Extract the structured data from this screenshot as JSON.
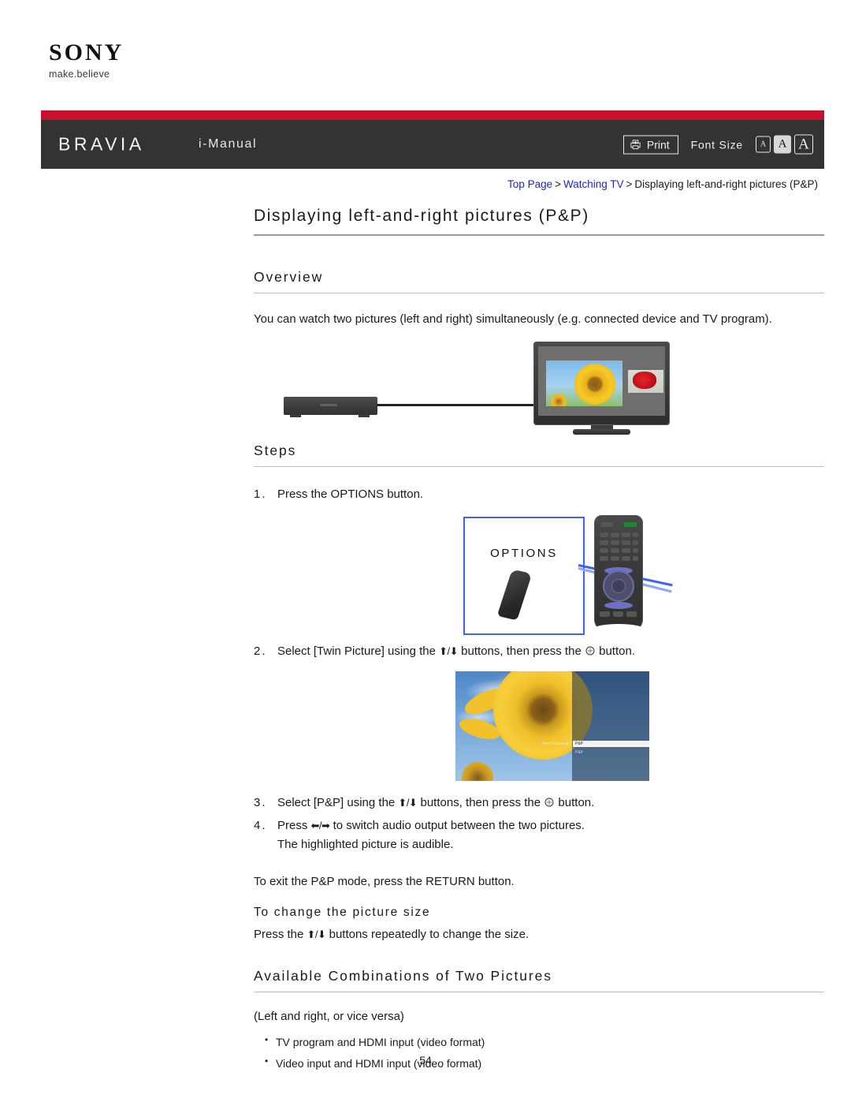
{
  "brand": {
    "logo_word": "SONY",
    "logo_tagline": "make.believe"
  },
  "header": {
    "product": "BRAVIA",
    "manual": "i-Manual",
    "print_label": "Print",
    "print_icon": "printer-icon",
    "font_size_label": "Font Size",
    "font_size_options": [
      "A",
      "A",
      "A"
    ],
    "font_size_selected_index": 1,
    "bar_red": "#c8102e",
    "bar_dark": "#333333"
  },
  "breadcrumb": {
    "items": [
      {
        "label": "Top Page",
        "link": true
      },
      {
        "label": "Watching TV",
        "link": true
      },
      {
        "label": "Displaying left-and-right pictures (P&P)",
        "link": false
      }
    ],
    "separator": ">",
    "link_color": "#2222cc"
  },
  "page": {
    "title": "Displaying left-and-right pictures (P&P)",
    "number": "54"
  },
  "overview": {
    "heading": "Overview",
    "body": "You can watch two pictures (left and right) simultaneously (e.g. connected device and TV program)."
  },
  "steps_section": {
    "heading": "Steps",
    "items": [
      {
        "num": "1.",
        "text_before": "Press the OPTIONS button.",
        "text_mid": "",
        "text_after": ""
      },
      {
        "num": "2.",
        "text_before": "Select [Twin Picture] using the ",
        "arrows": "⬆/⬇",
        "text_mid": " buttons, then press the ",
        "enter_icon": "enter-button-icon",
        "text_after": " button."
      },
      {
        "num": "3.",
        "text_before": "Select [P&P] using the ",
        "arrows": "⬆/⬇",
        "text_mid": " buttons, then press the ",
        "enter_icon": "enter-button-icon",
        "text_after": " button."
      },
      {
        "num": "4.",
        "text_before": "Press ",
        "arrows": "⬅/➡",
        "text_mid": " to switch audio output between the two pictures.",
        "note": "The highlighted picture is audible."
      }
    ],
    "exit_note": "To exit the P&P mode, press the RETURN button."
  },
  "picture_size": {
    "heading": "To change the picture size",
    "body_before": "Press the ",
    "arrows": "⬆/⬇",
    "body_after": " buttons repeatedly to change the size."
  },
  "combinations": {
    "heading": "Available Combinations of Two Pictures",
    "note": "(Left and right, or vice versa)",
    "items": [
      "TV program and HDMI input (video format)",
      "Video input and HDMI input (video format)"
    ]
  },
  "figures": {
    "options_callout": {
      "label": "OPTIONS",
      "border_color": "#3c64f0"
    },
    "osd": {
      "menu_label": "Twin Picture ▶",
      "selected_option": "P&P",
      "other_option": "P&P"
    }
  }
}
